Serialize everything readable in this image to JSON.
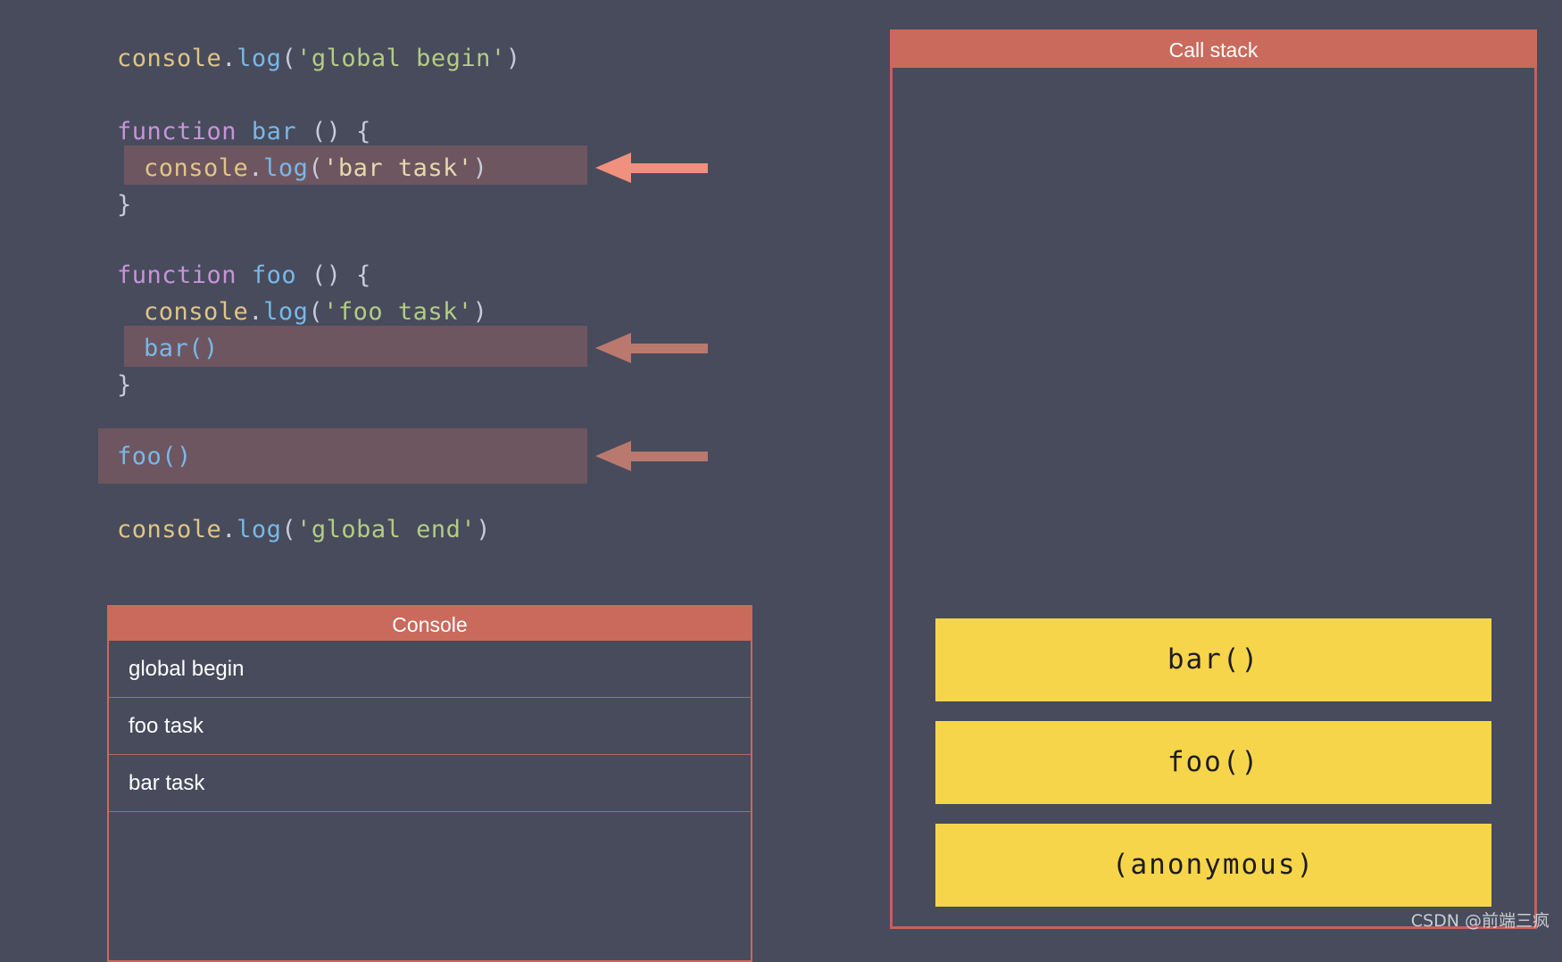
{
  "theme": {
    "background": "#474b5c",
    "panel_accent": "#ca6a5c",
    "highlight_band": "#6d5660",
    "stack_frame_color": "#f7d54a",
    "stack_frame_text": "#1d1d1d"
  },
  "code": {
    "language": "javascript",
    "lines": [
      {
        "id": "line-global-begin",
        "text": "console.log('global begin')",
        "highlighted": false
      },
      {
        "id": "line-function-bar",
        "text": "function bar () {",
        "highlighted": false
      },
      {
        "id": "line-bar-log",
        "text": "  console.log('bar task')",
        "highlighted": true
      },
      {
        "id": "line-bar-close",
        "text": "}",
        "highlighted": false
      },
      {
        "id": "line-function-foo",
        "text": "function foo () {",
        "highlighted": false
      },
      {
        "id": "line-foo-log",
        "text": "  console.log('foo task')",
        "highlighted": false
      },
      {
        "id": "line-foo-call-bar",
        "text": "  bar()",
        "highlighted": true
      },
      {
        "id": "line-foo-close",
        "text": "}",
        "highlighted": false
      },
      {
        "id": "line-call-foo",
        "text": "foo()",
        "highlighted": true
      },
      {
        "id": "line-global-end",
        "text": "console.log('global end')",
        "highlighted": false
      }
    ],
    "tokens": {
      "console": "console",
      "dot": ".",
      "log": "log",
      "open_paren": "(",
      "close_paren": ")",
      "str_global_begin": "'global begin'",
      "str_global_end": "'global end'",
      "str_bar_task": "'bar task'",
      "str_foo_task": "'foo task'",
      "keyword_function": "function",
      "name_bar": "bar",
      "name_foo": "foo",
      "empty_parens": "()",
      "parens_spaced": "() {",
      "brace_close": "}",
      "call_bar": "bar()",
      "call_foo": "foo()"
    }
  },
  "arrows": [
    {
      "id": "arrow-bar-log",
      "color": "#f0907e",
      "label": "points-to-bar-log"
    },
    {
      "id": "arrow-foo-call-bar",
      "color": "#b9796e",
      "label": "points-to-bar-call"
    },
    {
      "id": "arrow-call-foo",
      "color": "#b9796e",
      "label": "points-to-foo-call"
    }
  ],
  "console_panel": {
    "title": "Console",
    "rows": [
      "global begin",
      "foo task",
      "bar task"
    ],
    "empty_rows": 1
  },
  "call_stack_panel": {
    "title": "Call stack",
    "frames": [
      "bar()",
      "foo()",
      "(anonymous)"
    ]
  },
  "watermark": {
    "text": "CSDN @前端三疯"
  }
}
